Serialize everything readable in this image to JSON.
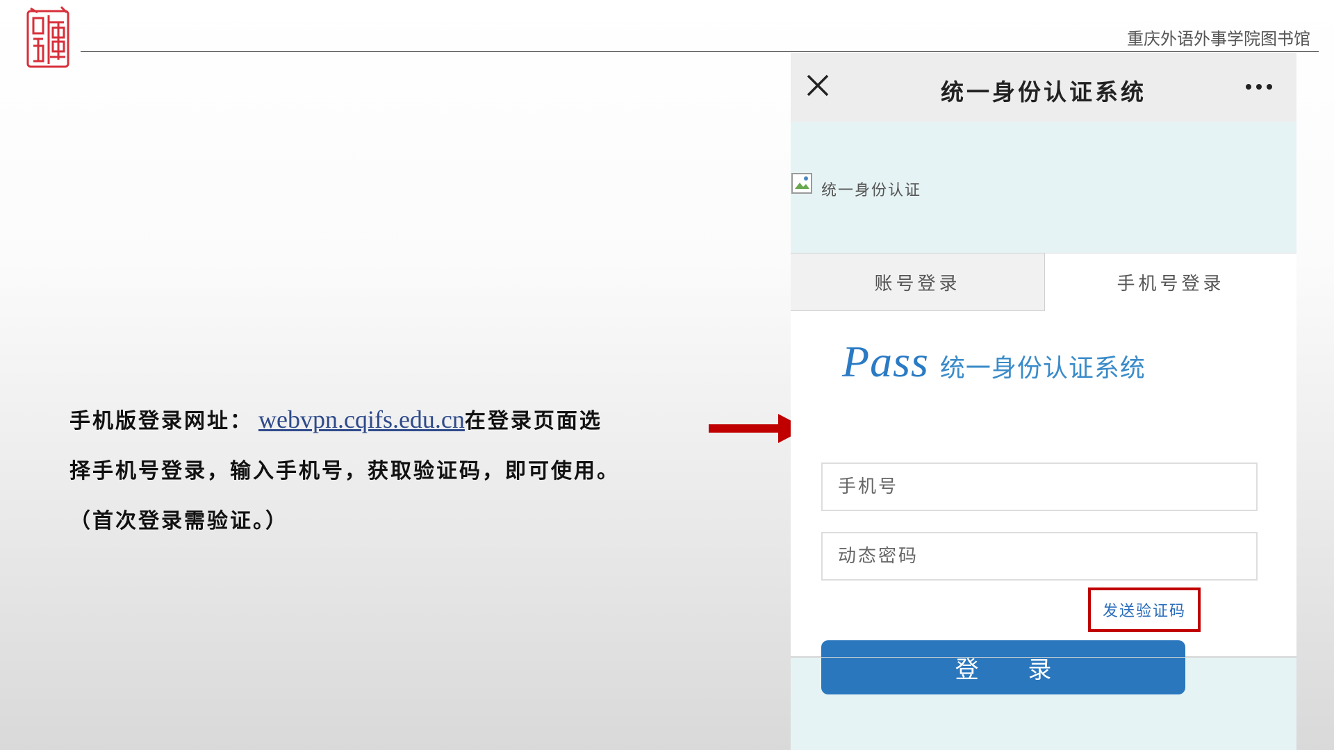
{
  "slide": {
    "library_name": "重庆外语外事学院图书馆",
    "seal_icon": "red-seal-logo",
    "instructions": {
      "label": "手机版登录网址：",
      "url": "webvpn.cqifs.edu.cn",
      "after_url": "在登录页面选",
      "line2": "择手机号登录，输入手机号，获取验证码，即可使用。",
      "line3": "（首次登录需验证。）"
    }
  },
  "phone": {
    "title": "统一身份认证系统",
    "close_icon": "close-icon",
    "more_icon": "more-dots-icon",
    "image_alt": "统一身份认证",
    "tabs": [
      {
        "label": "账号登录",
        "active": false
      },
      {
        "label": "手机号登录",
        "active": true
      }
    ],
    "logo": {
      "word": "Pass",
      "text": "统一身份认证系统"
    },
    "phone_field": {
      "placeholder": "手机号",
      "value": ""
    },
    "code_field": {
      "placeholder": "动态密码",
      "value": ""
    },
    "send_code_label": "发送验证码",
    "login_label": "登 录"
  },
  "colors": {
    "accent_red": "#c00000",
    "login_blue": "#2a77bd",
    "link_blue": "#2e4a8a",
    "phone_bg": "#e6f3f4"
  }
}
